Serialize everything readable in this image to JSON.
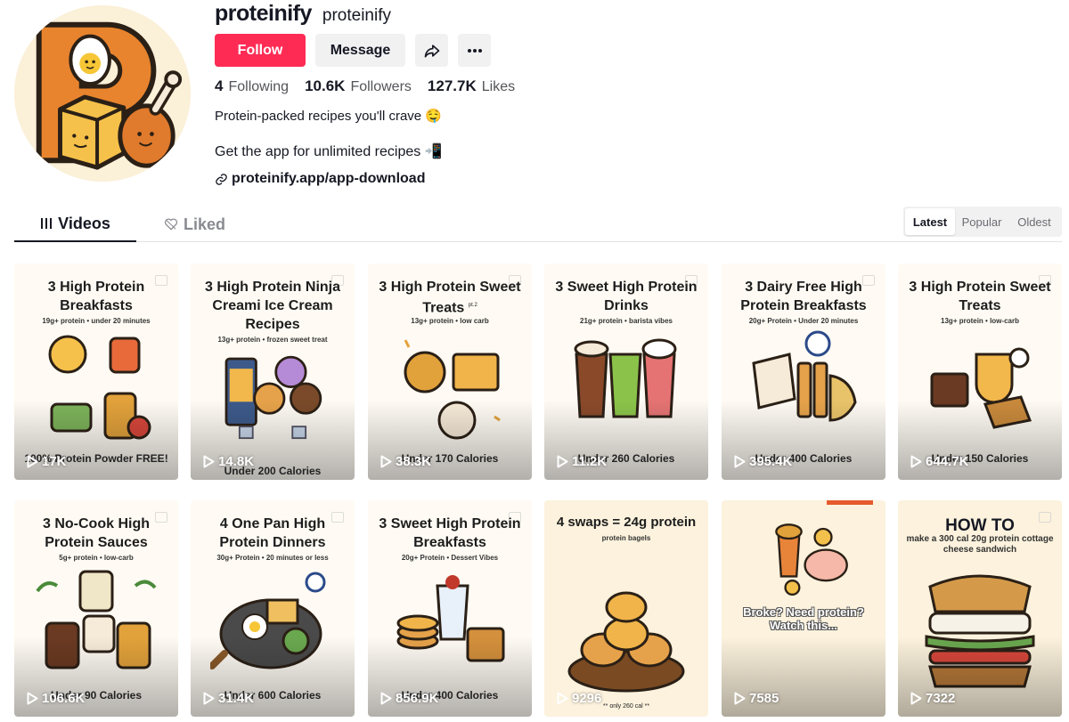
{
  "profile": {
    "username": "proteinify",
    "nickname": "proteinify",
    "follow_label": "Follow",
    "message_label": "Message",
    "stats": [
      {
        "num": "4",
        "label": "Following"
      },
      {
        "num": "10.6K",
        "label": "Followers"
      },
      {
        "num": "127.7K",
        "label": "Likes"
      }
    ],
    "bio_line1": "Protein-packed recipes you'll crave 🤤",
    "bio_line2": "Get the app for unlimited recipes 📲",
    "link": "proteinify.app/app-download"
  },
  "tabs": [
    {
      "label": "Videos",
      "icon": "grid-icon"
    },
    {
      "label": "Liked",
      "icon": "heart-outline-icon"
    }
  ],
  "sort": [
    "Latest",
    "Popular",
    "Oldest"
  ],
  "videos": [
    {
      "title": "3 High Protein Breakfasts",
      "subtitle": "19g+ protein • under 20 minutes",
      "bottom": "100% Protein Powder FREE!",
      "plays": "17K"
    },
    {
      "title": "3 High Protein Ninja Creami Ice Cream Recipes",
      "subtitle": "13g+ protein • frozen sweet treat",
      "bottom": "Under 200 Calories",
      "plays": "14.8K"
    },
    {
      "title": "3 High Protein Sweet Treats",
      "title_note": "pt.2",
      "subtitle": "13g+ protein • low carb",
      "bottom": "Under 170 Calories",
      "plays": "38.3K"
    },
    {
      "title": "3 Sweet High Protein Drinks",
      "subtitle": "21g+ protein • barista vibes",
      "bottom": "Under 260 Calories",
      "plays": "11.2K"
    },
    {
      "title": "3 Dairy Free High Protein Breakfasts",
      "subtitle": "20g+ Protein • Under 20 minutes",
      "bottom": "Under 400 Calories",
      "plays": "395.4K"
    },
    {
      "title": "3 High Protein Sweet Treats",
      "subtitle": "13g+ protein • low-carb",
      "bottom": "Under 150 Calories",
      "plays": "644.7K"
    },
    {
      "title": "3 No-Cook High Protein Sauces",
      "subtitle": "5g+ protein • low-carb",
      "bottom": "Under 90 Calories",
      "plays": "106.6K"
    },
    {
      "title": "4 One Pan High Protein Dinners",
      "subtitle": "30g+ Protein • 20 minutes or less",
      "bottom": "Under 600 Calories",
      "plays": "31.4K"
    },
    {
      "title": "3 Sweet High Protein Breakfasts",
      "subtitle": "20g+ Protein • Dessert Vibes",
      "bottom": "Under 400 Calories",
      "plays": "856.9K"
    },
    {
      "title": "4 swaps = 24g protein",
      "subtitle": "protein bagels",
      "bottom": "** only 260 cal **",
      "plays": "9296"
    },
    {
      "title": "",
      "overlay": "Broke? Need protein? Watch this...",
      "plays": "7585"
    },
    {
      "title": "HOW TO",
      "subtitle": "make a 300 cal 20g protein cottage cheese sandwich",
      "plays": "7322"
    }
  ]
}
